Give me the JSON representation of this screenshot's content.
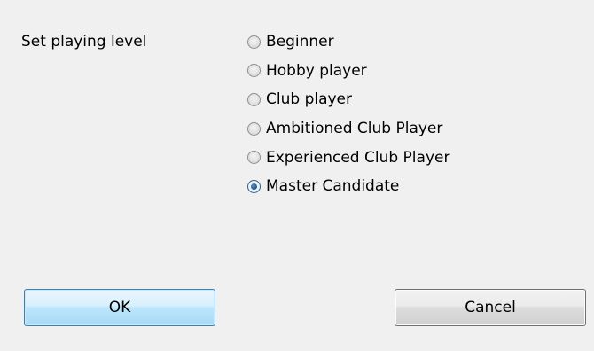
{
  "dialog": {
    "prompt": "Set playing level",
    "options": [
      {
        "label": "Beginner",
        "checked": false
      },
      {
        "label": "Hobby player",
        "checked": false
      },
      {
        "label": "Club player",
        "checked": false
      },
      {
        "label": "Ambitioned Club Player",
        "checked": false
      },
      {
        "label": "Experienced Club Player",
        "checked": false
      },
      {
        "label": "Master Candidate",
        "checked": true
      }
    ],
    "selected": "Master Candidate",
    "ok_label": "OK",
    "cancel_label": "Cancel"
  },
  "colors": {
    "background": "#f0f0f0",
    "ok_border": "#3c7fb1",
    "radio_dot": "#1b4f86"
  }
}
